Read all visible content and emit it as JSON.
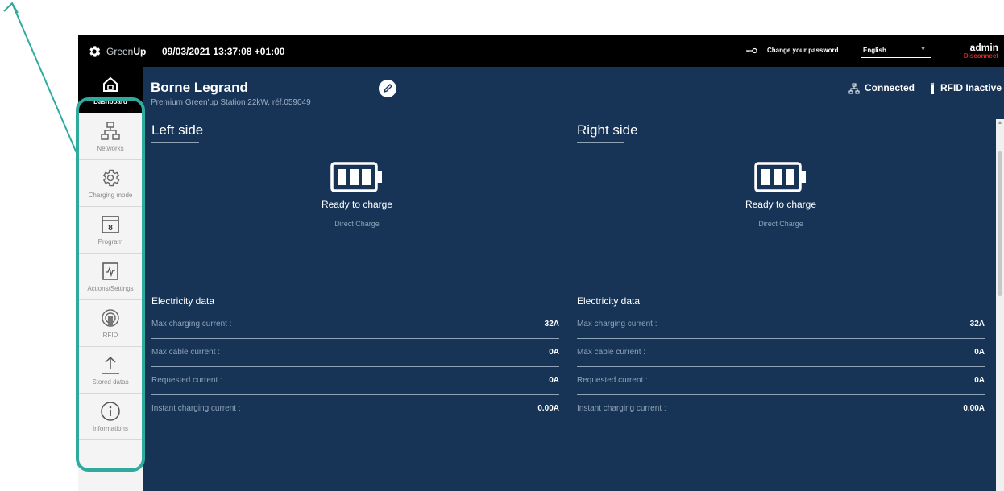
{
  "header": {
    "brand_light": "Green",
    "brand_bold": "Up",
    "datetime": "09/03/2021 13:37:08 +01:00",
    "change_password": "Change your password",
    "language": "English",
    "user": "admin",
    "disconnect": "Disconnect"
  },
  "sidebar": {
    "items": [
      {
        "label": "Dashboard",
        "icon": "home-icon",
        "active": true
      },
      {
        "label": "Networks",
        "icon": "network-icon"
      },
      {
        "label": "Charging mode",
        "icon": "gear-icon"
      },
      {
        "label": "Program",
        "icon": "calendar-icon",
        "badge": "8"
      },
      {
        "label": "Actions/Settings",
        "icon": "activity-icon"
      },
      {
        "label": "RFID",
        "icon": "rfid-icon"
      },
      {
        "label": "Stored datas",
        "icon": "upload-icon"
      },
      {
        "label": "Informations",
        "icon": "info-icon"
      }
    ]
  },
  "station": {
    "name": "Borne Legrand",
    "subtitle": "Premium Green'up Station 22kW, réf.059049"
  },
  "status": {
    "connection": "Connected",
    "rfid": "RFID Inactive"
  },
  "panels": [
    {
      "title": "Left side",
      "charge_status": "Ready to charge",
      "charge_mode": "Direct Charge",
      "electricity_title": "Electricity data",
      "rows": [
        {
          "label": "Max charging current :",
          "value": "32A"
        },
        {
          "label": "Max cable current :",
          "value": "0A"
        },
        {
          "label": "Requested current :",
          "value": "0A"
        },
        {
          "label": "Instant charging current :",
          "value": "0.00A"
        }
      ]
    },
    {
      "title": "Right side",
      "charge_status": "Ready to charge",
      "charge_mode": "Direct Charge",
      "electricity_title": "Electricity data",
      "rows": [
        {
          "label": "Max charging current :",
          "value": "32A"
        },
        {
          "label": "Max cable current :",
          "value": "0A"
        },
        {
          "label": "Requested current :",
          "value": "0A"
        },
        {
          "label": "Instant charging current :",
          "value": "0.00A"
        }
      ]
    }
  ],
  "colors": {
    "background": "#173456",
    "topbar": "#000000",
    "highlight": "#2eaa9f",
    "disconnect": "#e0232d"
  }
}
